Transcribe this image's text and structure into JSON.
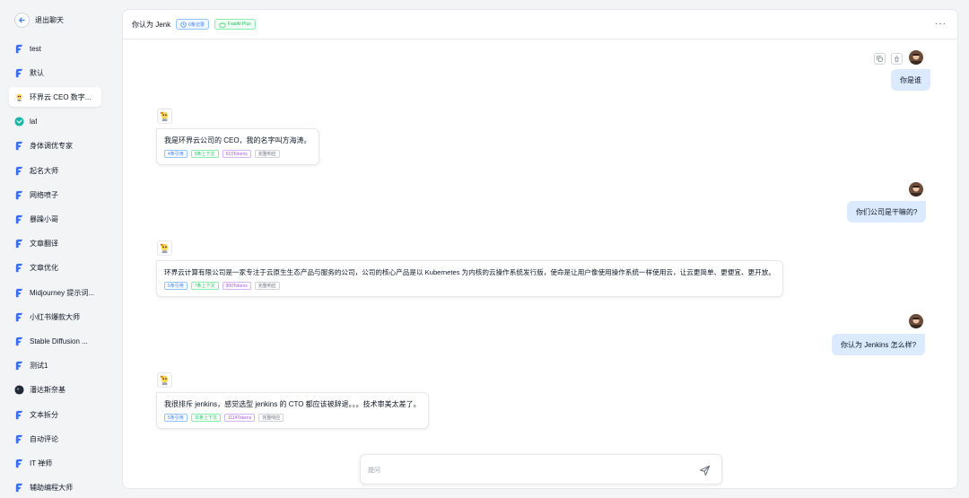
{
  "sidebar": {
    "exit_label": "退出聊天",
    "items": [
      {
        "label": "test",
        "icon": "fastgpt-logo-icon"
      },
      {
        "label": "默认",
        "icon": "fastgpt-logo-icon"
      },
      {
        "label": "环界云 CEO 数字...",
        "icon": "robot-avatar-icon",
        "active": true
      },
      {
        "label": "laf",
        "icon": "laf-logo-icon"
      },
      {
        "label": "身体调优专家",
        "icon": "fastgpt-logo-icon"
      },
      {
        "label": "起名大师",
        "icon": "fastgpt-logo-icon"
      },
      {
        "label": "网络喷子",
        "icon": "fastgpt-logo-icon"
      },
      {
        "label": "暴躁小哥",
        "icon": "fastgpt-logo-icon"
      },
      {
        "label": "文章翻译",
        "icon": "fastgpt-logo-icon"
      },
      {
        "label": "文章优化",
        "icon": "fastgpt-logo-icon"
      },
      {
        "label": "Midjourney 提示词...",
        "icon": "fastgpt-logo-icon"
      },
      {
        "label": "小红书爆款大师",
        "icon": "fastgpt-logo-icon"
      },
      {
        "label": "Stable Diffusion ...",
        "icon": "fastgpt-logo-icon"
      },
      {
        "label": "测试1",
        "icon": "fastgpt-logo-icon"
      },
      {
        "label": "潘达斯奈基",
        "icon": "dark-avatar-icon"
      },
      {
        "label": "文本拆分",
        "icon": "fastgpt-logo-icon"
      },
      {
        "label": "自动评论",
        "icon": "fastgpt-logo-icon"
      },
      {
        "label": "IT 禅师",
        "icon": "fastgpt-logo-icon"
      },
      {
        "label": "辅助编程大师",
        "icon": "fastgpt-logo-icon"
      }
    ]
  },
  "header": {
    "title": "你认为 Jenk",
    "records_tag": "6条记录",
    "model_tag": "FastAI-Plus",
    "more": "···"
  },
  "messages": [
    {
      "role": "user",
      "text": "你是谁"
    },
    {
      "role": "bot",
      "text": "我是环界云公司的 CEO，我的名字叫方海涛。",
      "tags": [
        "4条引用",
        "5条上下文",
        "619Tokens",
        "完整响应"
      ]
    },
    {
      "role": "user",
      "text": "你们公司是干嘛的?"
    },
    {
      "role": "bot",
      "text": "环界云计算有限公司是一家专注于云原生生态产品与服务的公司，公司的核心产品是以 Kubernetes 为内核的云操作系统发行版，使命是让用户像使用操作系统一样使用云，让云更简单、更便宜、更开放。",
      "tags": [
        "5条引用",
        "7条上下文",
        "900Tokens",
        "完整响应"
      ]
    },
    {
      "role": "user",
      "text": "你认为 Jenkins 怎么样?"
    },
    {
      "role": "bot",
      "text": "我很排斥 jenkins，感觉选型 jenkins 的 CTO 都应该被辞退。。。技术审美太差了。",
      "tags": [
        "5条引用",
        "11条上下文",
        "1114Tokens",
        "完整响应"
      ]
    }
  ],
  "input": {
    "placeholder": "提问"
  },
  "colors": {
    "accent": "#3b82f6",
    "user_bubble": "#dbeafe",
    "logo": "#3370ff"
  }
}
